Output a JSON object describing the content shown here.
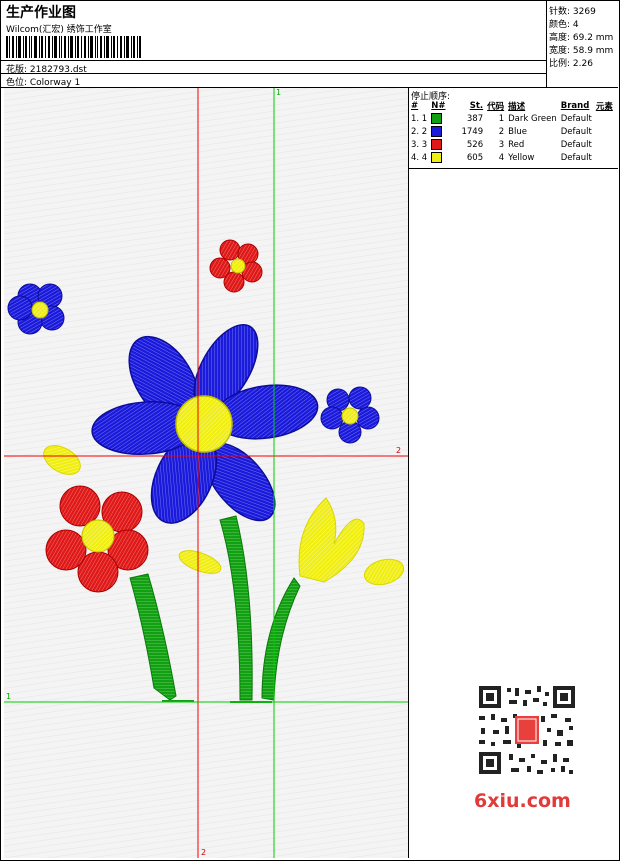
{
  "header": {
    "title": "生产作业图",
    "company": "Wilcom(汇宏) 绣饰工作室",
    "design_label": "花版: 2182793.dst",
    "colorway_label": "色位: Colorway 1"
  },
  "stats": {
    "stitches": "针数: 3269",
    "colors": "颜色: 4",
    "height": "高度: 69.2 mm",
    "width": "宽度: 58.9 mm",
    "scale": "比例: 2.26"
  },
  "stop_sequence": {
    "title": "停止顺序:",
    "columns": [
      "#",
      "N#",
      "St.",
      "代码",
      "描述",
      "Brand",
      "元素"
    ],
    "rows": [
      {
        "num": "1. 1",
        "color": "#11a011",
        "st": "387",
        "code": "1",
        "desc": "Dark Green",
        "brand": "Default"
      },
      {
        "num": "2. 2",
        "color": "#1a1adc",
        "st": "1749",
        "code": "2",
        "desc": "Blue",
        "brand": "Default"
      },
      {
        "num": "3. 3",
        "color": "#e01818",
        "st": "526",
        "code": "3",
        "desc": "Red",
        "brand": "Default"
      },
      {
        "num": "4. 4",
        "color": "#f0ee10",
        "st": "605",
        "code": "4",
        "desc": "Yellow",
        "brand": "Default"
      }
    ]
  },
  "guides": {
    "green_top": "1",
    "green_left": "1",
    "red_right": "2",
    "red_bottom": "2"
  },
  "watermark": {
    "text": "6xiu.com"
  },
  "colors": {
    "green": "#11a011",
    "blue": "#1a1adc",
    "red": "#e01818",
    "yellow": "#f0ee10"
  }
}
